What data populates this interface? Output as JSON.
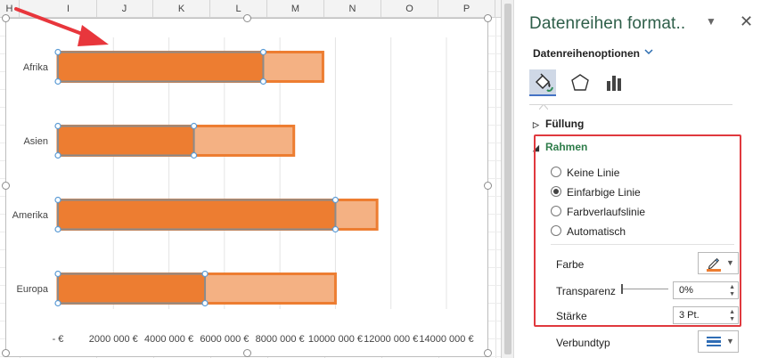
{
  "sheet": {
    "columns": [
      "H",
      "I",
      "J",
      "K",
      "L",
      "M",
      "N",
      "O",
      "P"
    ]
  },
  "chart_data": {
    "type": "bar",
    "orientation": "horizontal",
    "stacked": true,
    "categories": [
      "Afrika",
      "Asien",
      "Amerika",
      "Europa"
    ],
    "series": [
      {
        "values": [
          7400000,
          4900000,
          10000000,
          5300000
        ],
        "color": "#ed7d31"
      },
      {
        "values": [
          2150000,
          3600000,
          1500000,
          4700000
        ],
        "color": "#f4b183"
      }
    ],
    "xlim": [
      0,
      14000000
    ],
    "xticks": [
      0,
      2000000,
      4000000,
      6000000,
      8000000,
      10000000,
      12000000,
      14000000
    ],
    "xtick_labels": [
      "-  €",
      "2000 000 €",
      "4000 000 €",
      "6000 000 €",
      "8000 000 €",
      "10000 000 €",
      "12000 000 €",
      "14000 000 €"
    ],
    "grid": "vertical",
    "border_color": "#ed7d31",
    "selected_series_border_color": "#8b8b8b",
    "annotation_arrow_color": "#e8363c"
  },
  "pane": {
    "title": "Datenreihen format..",
    "options_label": "Datenreihenoptionen",
    "icons": [
      "fill-line-icon",
      "effects-icon",
      "series-options-icon"
    ],
    "sections": {
      "fill": "Füllung",
      "border": "Rahmen"
    },
    "border_options": [
      {
        "label": "Keine Linie",
        "checked": false
      },
      {
        "label": "Einfarbige Linie",
        "checked": true
      },
      {
        "label": "Farbverlaufslinie",
        "checked": false
      },
      {
        "label": "Automatisch",
        "checked": false
      }
    ],
    "color_label": "Farbe",
    "color_value": "#ed7d31",
    "transparency_label": "Transparenz",
    "transparency_value": "0%",
    "transparency_fraction": 0,
    "width_label": "Stärke",
    "width_value": "3 Pt.",
    "compound_label": "Verbundtyp",
    "highlight_color": "#e0393e"
  }
}
